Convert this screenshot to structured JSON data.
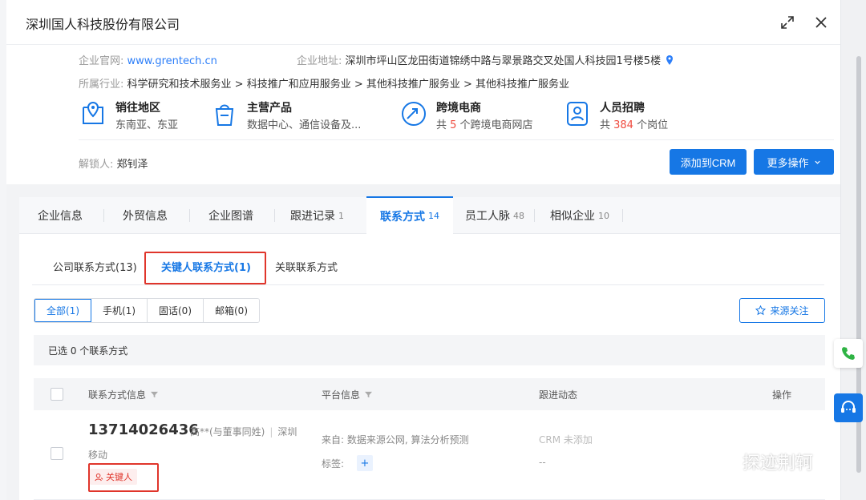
{
  "modal": {
    "title": "深圳国人科技股份有限公司"
  },
  "company": {
    "website_label": "企业官网:",
    "website": "www.grentech.cn",
    "address_label": "企业地址:",
    "address": "深圳市坪山区龙田街道锦绣中路与翠景路交叉处国人科技园1号楼5楼",
    "industry_label": "所属行业:",
    "industry": "科学研究和技术服务业 > 科技推广和应用服务业 > 其他科技推广服务业 > 其他科技推广服务业",
    "unlocker_label": "解锁人:",
    "unlocker": "郑钊泽"
  },
  "features": [
    {
      "title": "销往地区",
      "sub": "东南亚、东亚",
      "icon": "map-location-icon"
    },
    {
      "title": "主营产品",
      "sub": "数据中心、通信设备及...",
      "icon": "shopping-bag-icon"
    },
    {
      "title": "跨境电商",
      "sub_prefix": "共 ",
      "count": "5",
      "sub_suffix": " 个跨境电商网店",
      "icon": "ecommerce-arrow-icon"
    },
    {
      "title": "人员招聘",
      "sub_prefix": "共 ",
      "count": "384",
      "sub_suffix": " 个岗位",
      "icon": "person-card-icon"
    }
  ],
  "actions": {
    "add_crm": "添加到CRM",
    "more": "更多操作"
  },
  "main_tabs": [
    {
      "label": "企业信息",
      "count": ""
    },
    {
      "label": "外贸信息",
      "count": ""
    },
    {
      "label": "企业图谱",
      "count": ""
    },
    {
      "label": "跟进记录",
      "count": "1"
    },
    {
      "label": "联系方式",
      "count": "14"
    },
    {
      "label": "员工人脉",
      "count": "48"
    },
    {
      "label": "相似企业",
      "count": "10"
    }
  ],
  "sub_tabs": [
    {
      "label": "公司联系方式(13)"
    },
    {
      "label": "关键人联系方式(1)"
    },
    {
      "label": "关联联系方式"
    }
  ],
  "filters": [
    {
      "label": "全部(1)"
    },
    {
      "label": "手机(1)"
    },
    {
      "label": "固话(0)"
    },
    {
      "label": "邮箱(0)"
    }
  ],
  "source_follow": "来源关注",
  "selected_text": "已选 0 个联系方式",
  "table": {
    "headers": [
      "联系方式信息",
      "平台信息",
      "跟进动态",
      "操作"
    ],
    "rows": [
      {
        "phone": "13714026436",
        "owner": "高**(与董事同姓)",
        "city": "深圳",
        "carrier": "移动",
        "badge": "关键人",
        "source": "来自: 数据来源公网, 算法分析预测",
        "tag_label": "标签:",
        "tag_add": "+",
        "crm": "CRM 未添加",
        "follow": "--"
      }
    ]
  },
  "watermark": "探迹荆轲",
  "colors": {
    "primary": "#1677e5",
    "highlight": "#e0352b",
    "count": "#ef4b3f"
  }
}
